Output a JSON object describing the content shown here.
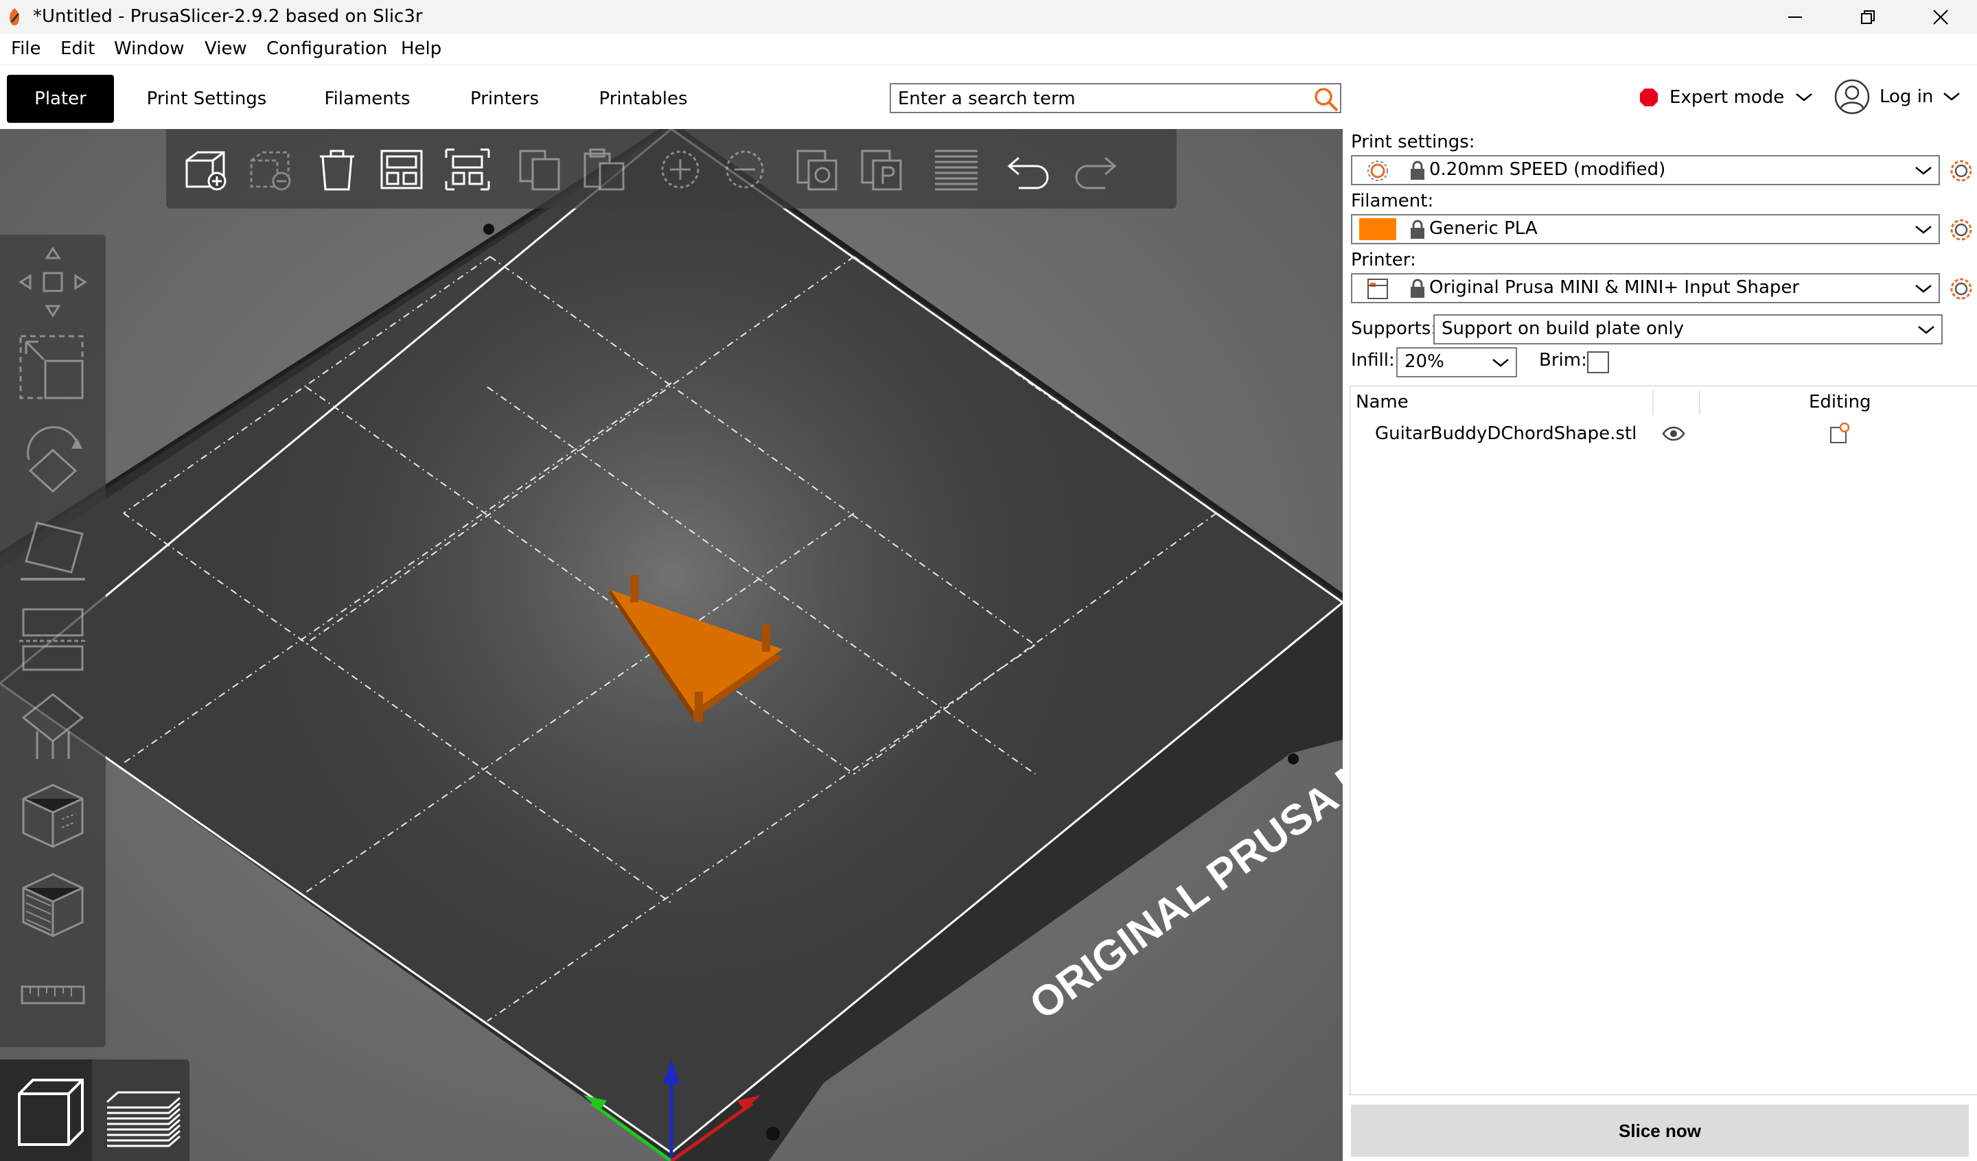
{
  "window": {
    "title": "*Untitled - PrusaSlicer-2.9.2 based on Slic3r",
    "accent": "#ed6b21"
  },
  "menu": {
    "items": [
      "File",
      "Edit",
      "Window",
      "View",
      "Configuration",
      "Help"
    ]
  },
  "tabs": {
    "items": [
      "Plater",
      "Print Settings",
      "Filaments",
      "Printers",
      "Printables"
    ],
    "active": "Plater"
  },
  "search": {
    "placeholder": "Enter a search term"
  },
  "mode": {
    "label": "Expert mode",
    "color": "#e8001c"
  },
  "account": {
    "login_label": "Log in"
  },
  "viewport": {
    "bed_label": "ORIGINAL PRUSA MI",
    "object_color": "#d96f00",
    "axis_colors": {
      "x": "#cc1a1a",
      "y": "#1ec81e",
      "z": "#1e28c8"
    }
  },
  "sidebar": {
    "print_settings_label": "Print settings:",
    "print_settings_value": "0.20mm SPEED (modified)",
    "filament_label": "Filament:",
    "filament_value": "Generic PLA",
    "filament_color": "#ff8000",
    "printer_label": "Printer:",
    "printer_value": "Original Prusa MINI & MINI+ Input Shaper",
    "supports_label": "Supports:",
    "supports_value": "Support on build plate only",
    "infill_label": "Infill:",
    "infill_value": "20%",
    "brim_label": "Brim:",
    "brim_checked": false
  },
  "object_list": {
    "headers": {
      "name": "Name",
      "editing": "Editing"
    },
    "rows": [
      {
        "name": "GuitarBuddyDChordShape.stl"
      }
    ]
  },
  "slice": {
    "label": "Slice now"
  }
}
